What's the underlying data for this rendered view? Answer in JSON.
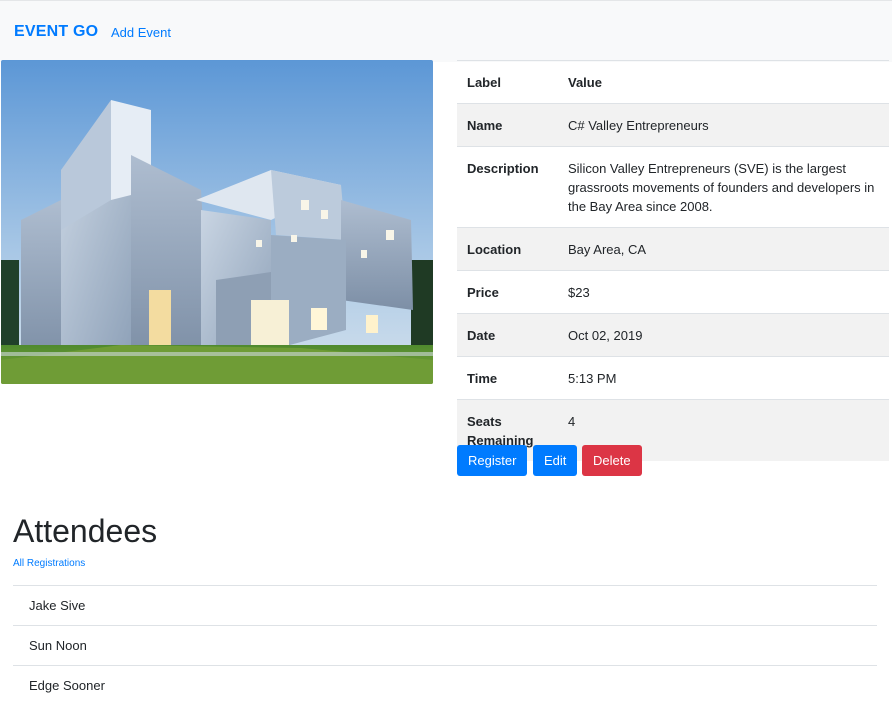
{
  "navbar": {
    "brand": "EVENT GO",
    "links": [
      {
        "label": "Add Event"
      }
    ]
  },
  "event_image": {
    "alt": "Modern building exterior with stacked aluminum boxes"
  },
  "details": {
    "headers": {
      "label": "Label",
      "value": "Value"
    },
    "rows": [
      {
        "label": "Name",
        "value": "C# Valley Entrepreneurs"
      },
      {
        "label": "Description",
        "value": "Silicon Valley Entrepreneurs (SVE) is the largest grassroots movements of founders and developers in the Bay Area since 2008."
      },
      {
        "label": "Location",
        "value": "Bay Area, CA"
      },
      {
        "label": "Price",
        "value": "$23"
      },
      {
        "label": "Date",
        "value": "Oct 02, 2019"
      },
      {
        "label": "Time",
        "value": "5:13 PM"
      },
      {
        "label": "Seats Remaining",
        "value": "4"
      }
    ]
  },
  "actions": {
    "register": "Register",
    "edit": "Edit",
    "delete": "Delete"
  },
  "attendees": {
    "title": "Attendees",
    "all_registrations_link": "All Registrations",
    "items": [
      "Jake Sive",
      "Sun Noon",
      "Edge Sooner"
    ]
  },
  "colors": {
    "primary": "#007bff",
    "danger": "#dc3545",
    "navbar_bg": "#f8f9fa",
    "stripe": "#f2f2f2"
  }
}
